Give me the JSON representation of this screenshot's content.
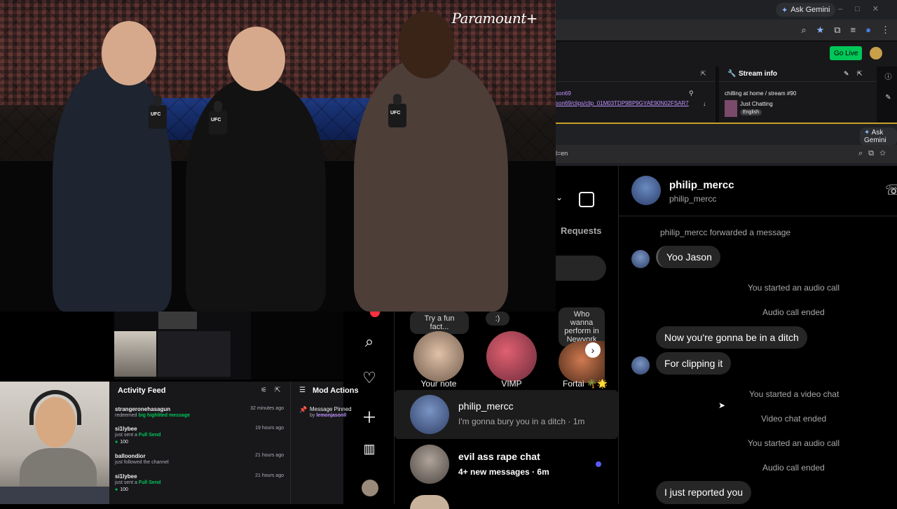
{
  "video": {
    "brand": "Paramount+",
    "mic_logo": "UFC"
  },
  "browser_top": {
    "ask_gemini": "Ask Gemini",
    "go_live": "Go Live",
    "clip_user": "son69",
    "clip_url": "son69/clips/clip_01M03TDP9BP9GYAE90N02FSAR7"
  },
  "stream_info": {
    "title": "Stream info",
    "stream_title": "chilling at home / stream #90",
    "category": "Just Chatting",
    "language": "English"
  },
  "browser2": {
    "ask_gemini": "Ask Gemini",
    "url_fragment": "l=en"
  },
  "ig": {
    "requests": "Requests",
    "chat_name": "philip_mercc",
    "chat_handle": "philip_mercc",
    "messages": [
      {
        "type": "system",
        "text": "philip_mercc forwarded a message"
      },
      {
        "type": "incoming",
        "text": "Yoo Jason"
      },
      {
        "type": "system",
        "text": "You started an audio call"
      },
      {
        "type": "system",
        "text": "Audio call ended"
      },
      {
        "type": "incoming",
        "text": "Now you're gonna be in a ditch"
      },
      {
        "type": "incoming",
        "text": "For clipping it"
      },
      {
        "type": "system",
        "text": "You started a video chat"
      },
      {
        "type": "system",
        "text": "Video chat ended"
      },
      {
        "type": "system",
        "text": "You started an audio call"
      },
      {
        "type": "system",
        "text": "Audio call ended"
      },
      {
        "type": "incoming",
        "text": "I just reported you"
      }
    ]
  },
  "dm_list": {
    "notes": [
      {
        "bubble": "Try a fun fact...",
        "label": "Your note"
      },
      {
        "bubble": ":)",
        "label": "VIMP"
      },
      {
        "bubble": "Who wanna perform in Newyork",
        "label": "Fortai 🌴🌟"
      }
    ],
    "rows": [
      {
        "name": "philip_mercc",
        "sub": "I'm gonna bury you in a ditch · 1m"
      },
      {
        "name": "evil ass rape chat",
        "sub": "4+ new messages · 6m"
      }
    ]
  },
  "activity": {
    "title": "Activity Feed",
    "items": [
      {
        "user": "strangeronehasagun",
        "time": "32 minutes ago",
        "text_pre": "redeemed",
        "text_hl": "big highlited message",
        "amount": ""
      },
      {
        "user": "si1lybee",
        "time": "19 hours ago",
        "text_pre": "just sent a",
        "text_hl": "Full Send",
        "amount": "100"
      },
      {
        "user": "balloondior",
        "time": "21 hours ago",
        "text_pre": "just followed the channel",
        "text_hl": "",
        "amount": ""
      },
      {
        "user": "si1lybee",
        "time": "21 hours ago",
        "text_pre": "just sent a",
        "text_hl": "Full Send",
        "amount": "100"
      }
    ]
  },
  "mod": {
    "title": "Mod Actions",
    "pin": "Message Pinned",
    "by_pre": "by",
    "by_user": "lemonjasonll"
  }
}
